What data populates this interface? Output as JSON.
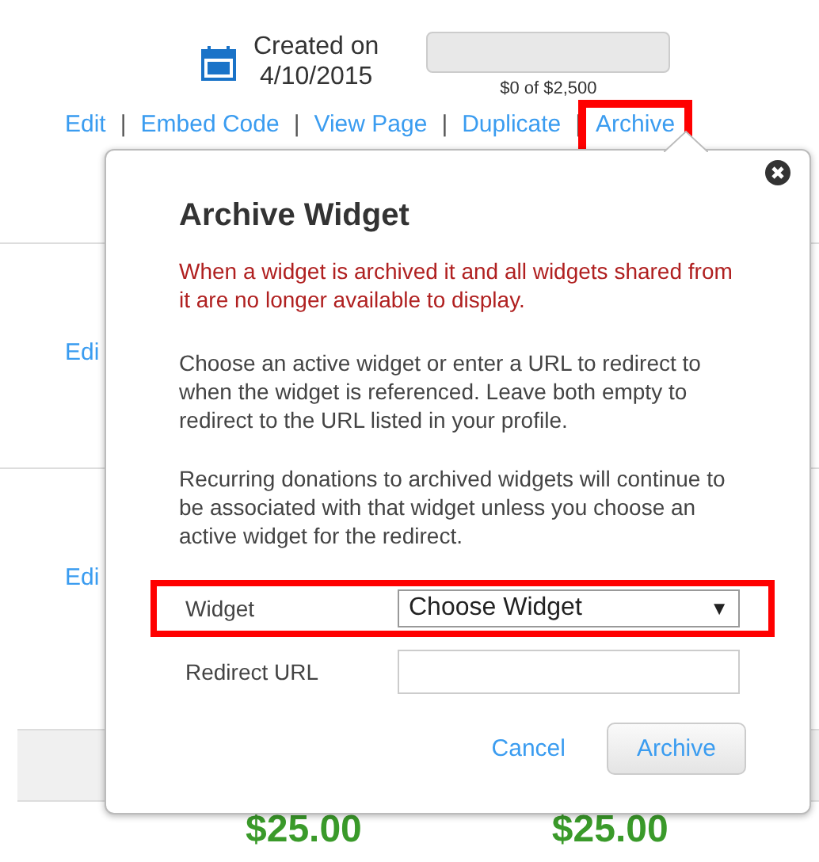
{
  "widget": {
    "created_label": "Created on",
    "created_date": "4/10/2015",
    "progress": {
      "level": 0,
      "reading": "$0 of $2,500"
    },
    "separator": "|",
    "links": [
      {
        "label": "Edit",
        "highlighted": false
      },
      {
        "label": "Embed Code",
        "highlighted": false
      },
      {
        "label": "View Page",
        "highlighted": false
      },
      {
        "label": "Duplicate",
        "highlighted": false
      },
      {
        "label": "Archive",
        "highlighted": true
      }
    ]
  },
  "rows": [
    {
      "link": "Edi"
    },
    {
      "link": "Edi"
    }
  ],
  "amounts": [
    "$25.00",
    "$25.00"
  ],
  "dialog": {
    "title": "Archive Widget",
    "warning": "When a widget is archived it and all widgets shared from it are no longer available to display.",
    "paragraphs": [
      "Choose an active widget or enter a URL to redirect to when the widget is referenced. Leave both empty to redirect to the URL listed in your profile.",
      "Recurring donations to archived widgets will continue to be associated with that widget unless you choose an active widget for the redirect."
    ],
    "fields": [
      {
        "kind": "select",
        "label": "Widget",
        "value": "Choose Widget",
        "arrow": "▼",
        "highlighted": true
      },
      {
        "kind": "text",
        "label": "Redirect URL",
        "highlighted": false
      }
    ],
    "cancel": "Cancel",
    "confirm": "Archive"
  }
}
